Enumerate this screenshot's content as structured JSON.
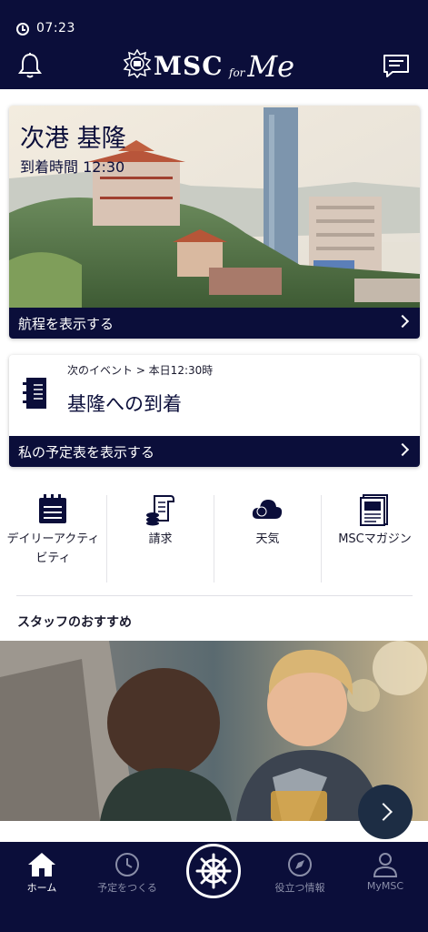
{
  "status_bar": {
    "time": "07:23"
  },
  "header": {
    "logo_brand": "MSC",
    "logo_for": "for",
    "logo_me": "Me"
  },
  "port_card": {
    "title": "次港 基隆",
    "arrival": "到着時間 12:30",
    "footer_label": "航程を表示する"
  },
  "event_card": {
    "meta": "次のイベント > 本日12:30時",
    "title": "基隆への到着",
    "footer_label": "私の予定表を表示する"
  },
  "quick_links": [
    {
      "label": "デイリーアクティビティ",
      "icon": "calendar-icon"
    },
    {
      "label": "請求",
      "icon": "receipt-icon"
    },
    {
      "label": "天気",
      "icon": "cloud-icon"
    },
    {
      "label": "MSCマガジン",
      "icon": "magazine-icon"
    }
  ],
  "staff_section": {
    "title": "スタッフのおすすめ"
  },
  "tab_bar": {
    "items": [
      {
        "label": "ホーム",
        "icon": "home-icon",
        "active": true
      },
      {
        "label": "予定をつくる",
        "icon": "clock-icon",
        "active": false
      },
      {
        "label": "",
        "icon": "ship-wheel-icon",
        "active": false
      },
      {
        "label": "役立つ情報",
        "icon": "compass-icon",
        "active": false
      },
      {
        "label": "MyMSC",
        "icon": "user-icon",
        "active": false
      }
    ]
  },
  "colors": {
    "navy": "#0b0e3a",
    "inactive": "#8a8ea8"
  }
}
